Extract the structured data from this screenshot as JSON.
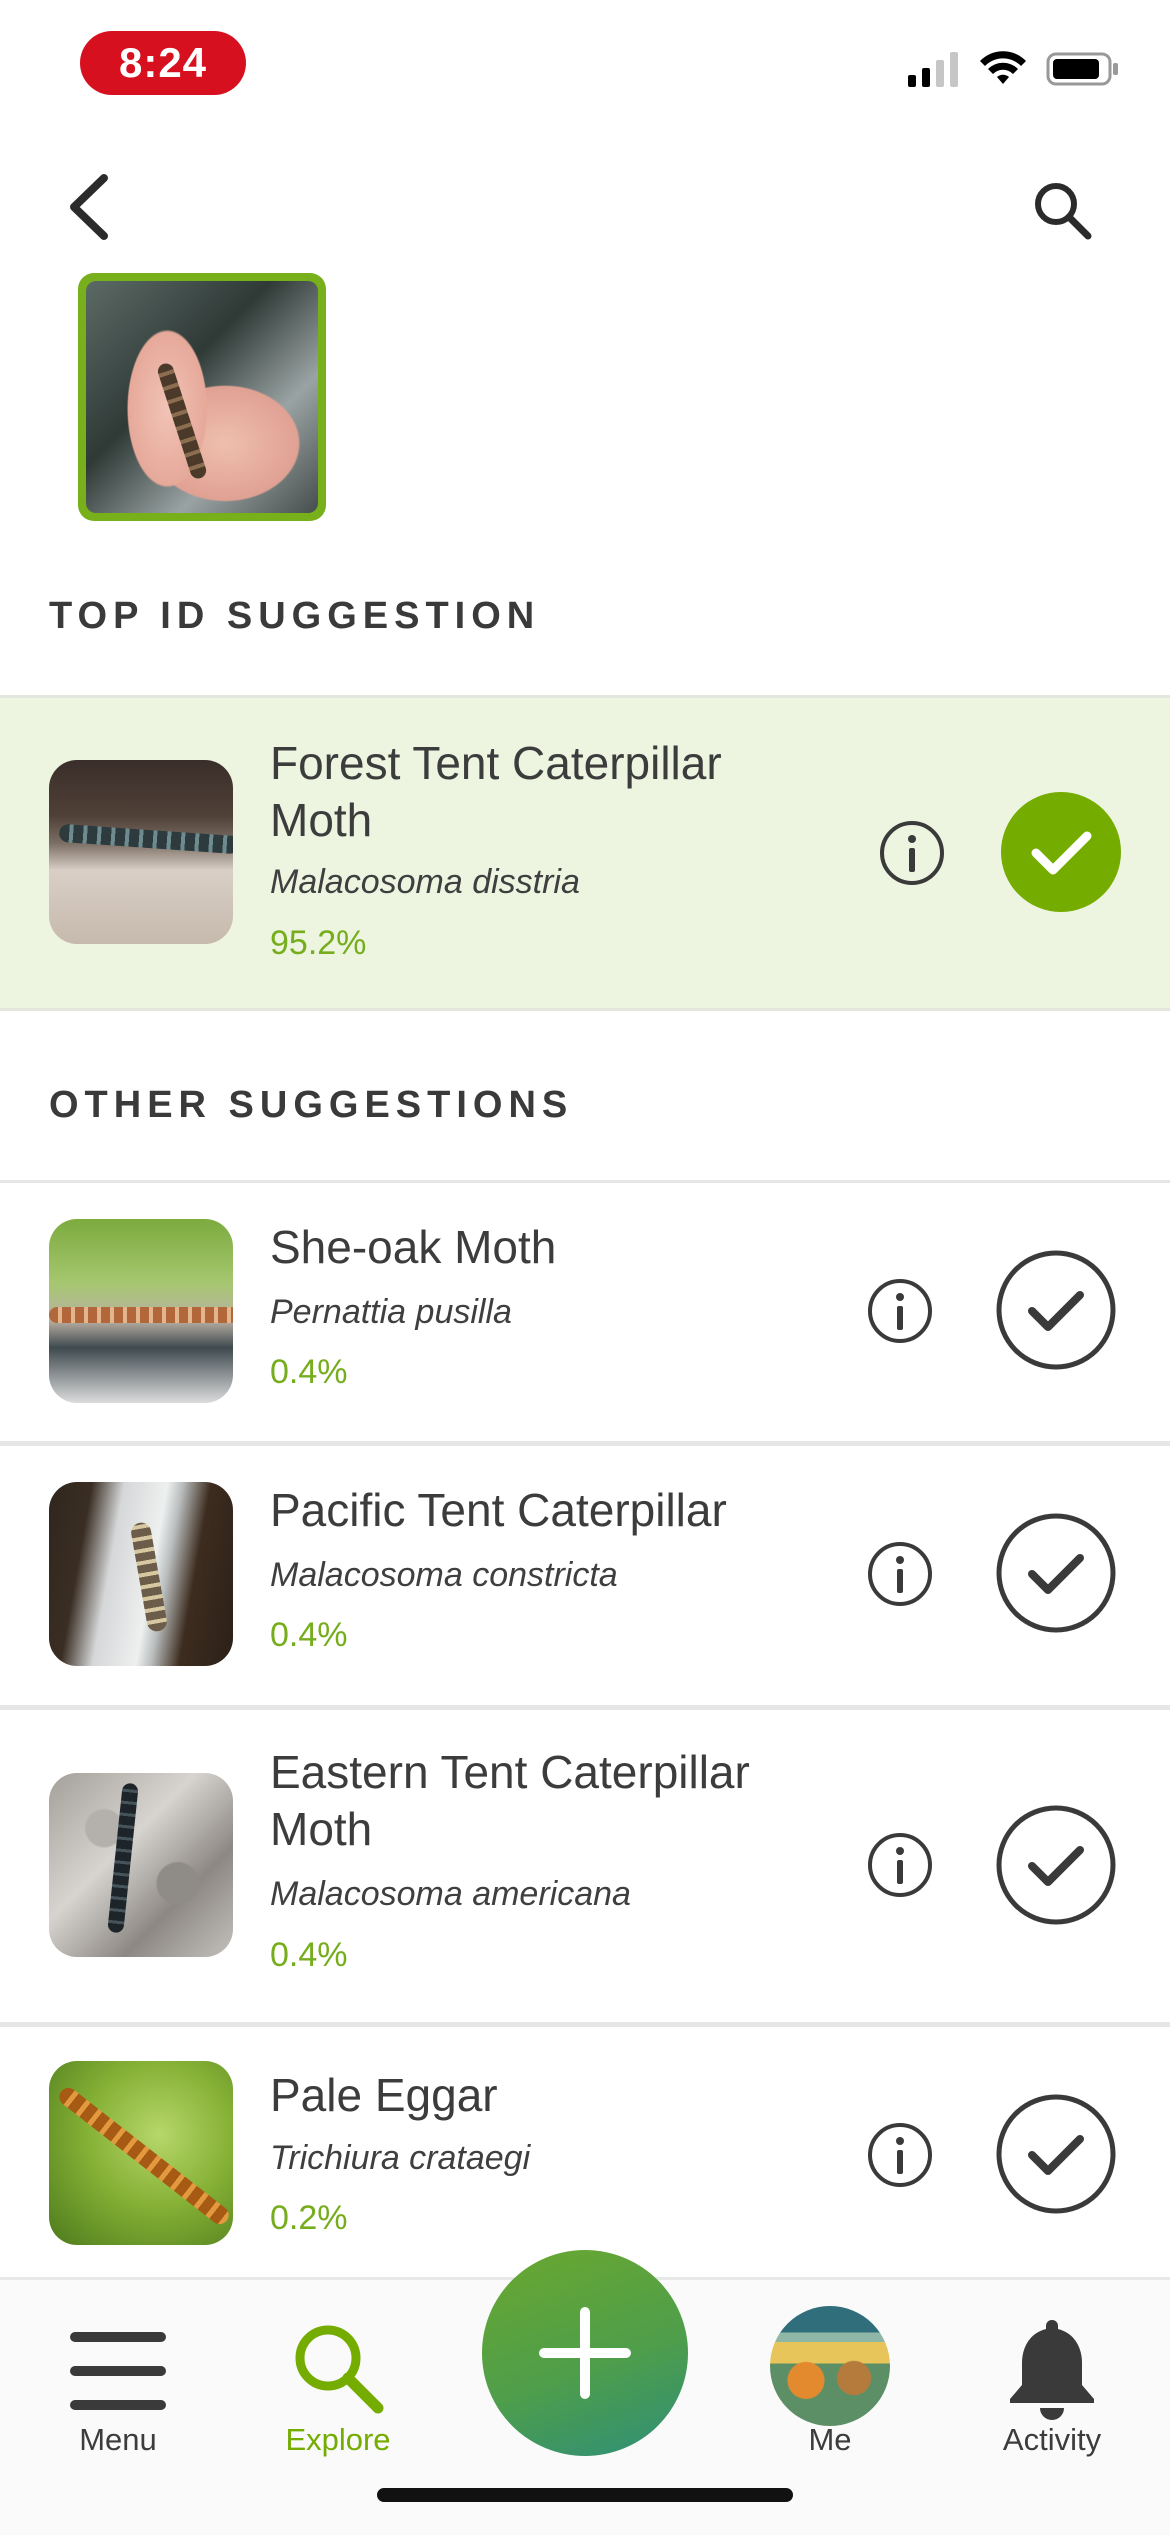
{
  "status_bar": {
    "time": "8:24"
  },
  "header": {
    "back_icon": "chevron-left-icon",
    "search_icon": "search-icon"
  },
  "top_section": {
    "title": "TOP ID SUGGESTION",
    "suggestion": {
      "name": "Forest Tent Caterpillar Moth",
      "name_line1": "Forest Tent Caterpillar",
      "name_line2": "Moth",
      "scientific": "Malacosoma disstria",
      "score": "95.2%"
    }
  },
  "other_section": {
    "title": "OTHER SUGGESTIONS",
    "suggestions": [
      {
        "name": "She-oak Moth",
        "scientific": "Pernattia pusilla",
        "score": "0.4%"
      },
      {
        "name": "Pacific Tent Caterpillar",
        "scientific": "Malacosoma constricta",
        "score": "0.4%"
      },
      {
        "name_line1": "Eastern Tent Caterpillar",
        "name_line2": "Moth",
        "scientific": "Malacosoma americana",
        "score": "0.4%"
      },
      {
        "name": "Pale Eggar",
        "scientific": "Trichiura crataegi",
        "score": "0.2%"
      }
    ]
  },
  "tabbar": {
    "menu": "Menu",
    "explore": "Explore",
    "me": "Me",
    "activity": "Activity"
  },
  "colors": {
    "accent": "#74ac00",
    "status_pill": "#d7101f",
    "top_row_bg": "#edf4e0"
  }
}
